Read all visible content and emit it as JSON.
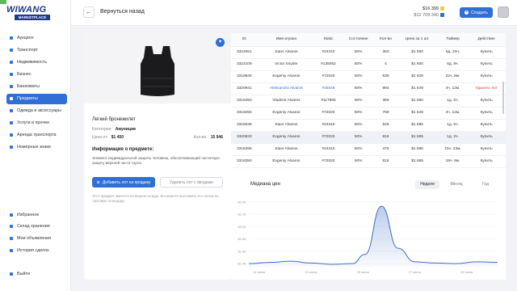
{
  "logo": {
    "title": "WIWANG",
    "subtitle": "MARKETPLACE"
  },
  "nav": [
    {
      "label": "Аукцион",
      "name": "nav-auction"
    },
    {
      "label": "Транспорт",
      "name": "nav-transport"
    },
    {
      "label": "Недвижимость",
      "name": "nav-realty"
    },
    {
      "label": "Бизнес",
      "name": "nav-business"
    },
    {
      "label": "Банкоматы",
      "name": "nav-atms"
    },
    {
      "label": "Предметы",
      "name": "nav-items",
      "active": true
    },
    {
      "label": "Одежда и аксессуары",
      "name": "nav-clothes"
    },
    {
      "label": "Услуги и прочее",
      "name": "nav-services"
    },
    {
      "label": "Аренда транспорта",
      "name": "nav-rent"
    },
    {
      "label": "Номерные знаки",
      "name": "nav-plates"
    }
  ],
  "nav_bottom": [
    {
      "label": "Избранное",
      "name": "nav-favorites"
    },
    {
      "label": "Склад хранения",
      "name": "nav-storage"
    },
    {
      "label": "Мои объявления",
      "name": "nav-my-ads"
    },
    {
      "label": "История сделок",
      "name": "nav-history"
    }
  ],
  "logout": "Выйти",
  "header": {
    "back": "Вернуться назад",
    "balance1": "$16 399",
    "balance2": "$12 709 340",
    "create": "Создать"
  },
  "product": {
    "name": "Легкий бронежилет",
    "category_label": "Категория:",
    "category": "Амуниция",
    "price_label": "Цена от:",
    "price": "$1 450",
    "count_label": "Кол-во:",
    "count": "15 946",
    "info_title": "Информация о предмете:",
    "description": "Элемент индивидуальной защиты человека, обеспечивающий частичную защиту верхней части торса.",
    "sell_button": "Добавить лот на продажу",
    "remove_button": "Удалить лот с продажи",
    "note": "Этот предмет имеется на вашем складе. Вы можете выставить его лотом на торговую площадку"
  },
  "table": {
    "columns": [
      "ID",
      "Имя игрока",
      "Static",
      "Состояние",
      "Кол-во",
      "Цена за 1 шт.",
      "Таймер",
      "Действие"
    ],
    "rows": [
      [
        "3322061",
        "Stavr Alvaros",
        "#24310",
        "50%",
        "363",
        "$1 550",
        "6д. 23ч.",
        "Купить"
      ],
      [
        "3322109",
        "Victor Snyder",
        "#135052",
        "50%",
        "4",
        "$1 600",
        "6д. 8ч.",
        "Купить"
      ],
      [
        "3319846",
        "Evgeniy Alvaros",
        "#72020",
        "50%",
        "636",
        "$1 629",
        "22ч. 8м.",
        "Купить"
      ],
      [
        "3320941",
        "Aleksandra Alvaros",
        "#45548",
        "50%",
        "894",
        "$1 649",
        "4ч. 12м.",
        "Удалить лот"
      ],
      [
        "3319450",
        "Vladimir Alvaros",
        "#117895",
        "50%",
        "359",
        "$1 650",
        "1д. 5ч.",
        "Купить"
      ],
      [
        "3319256",
        "Evgeniy Alvaros",
        "#72020",
        "50%",
        "758",
        "$1 649",
        "4ч. 12м.",
        "Купить"
      ],
      [
        "3318038",
        "Stavr Alvaros",
        "#24310",
        "50%",
        "526",
        "$1 685",
        "1д. 5ч.",
        "Купить"
      ],
      [
        "3320633",
        "Evgeniy Alvaros",
        "#72020",
        "50%",
        "816",
        "$1 685",
        "1д. 2ч.",
        "Купить"
      ],
      [
        "3316295",
        "Stavr Alvaros",
        "#24310",
        "50%",
        "476",
        "$1 685",
        "15ч. 23м.",
        "Купить"
      ],
      [
        "3318350",
        "Evgeniy Alvaros",
        "#72020",
        "50%",
        "816",
        "$1 685",
        "18ч. 8м.",
        "Купить"
      ]
    ],
    "highlight_rows": [
      7
    ],
    "self_row": 3
  },
  "chart_title": "Медиана цен",
  "chart_tabs": [
    "Неделя",
    "Месяц",
    "Год"
  ],
  "chart_data": {
    "type": "area",
    "x": [
      "11 июня",
      "13 июня",
      "15 июня",
      "17 июня",
      "19 июня",
      "21 июня"
    ],
    "yticks": [
      "$1.4K",
      "$1.6K",
      "$1.8K",
      "$2.0K",
      "$2.2K",
      "$2.4K"
    ],
    "ylim": [
      1350,
      2450
    ],
    "points": [
      [
        0,
        1400
      ],
      [
        0.5,
        1420
      ],
      [
        1,
        1440
      ],
      [
        1.5,
        1410
      ],
      [
        2,
        1390
      ],
      [
        2.5,
        1400
      ],
      [
        2.8,
        1550
      ],
      [
        3.2,
        2330
      ],
      [
        3.6,
        1650
      ],
      [
        4,
        1430
      ],
      [
        4.5,
        1410
      ],
      [
        5,
        1400
      ],
      [
        5.5,
        1430
      ],
      [
        6,
        1420
      ]
    ],
    "color": "#3d6fc4"
  }
}
